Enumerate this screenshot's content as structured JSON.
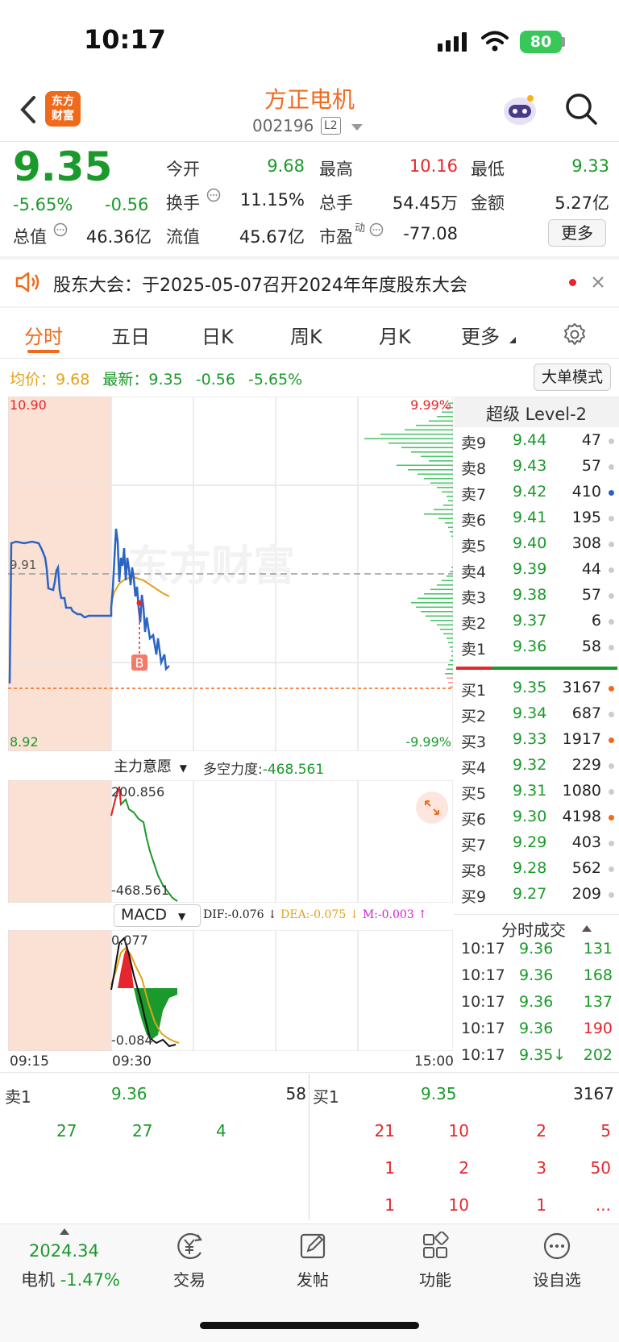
{
  "status_bar": {
    "time": "10:17",
    "battery": "80"
  },
  "header": {
    "logo_text": "东方\n财富",
    "title": "方正电机",
    "code": "002196",
    "level_badge": "L2"
  },
  "quote": {
    "price": "9.35",
    "change_pct": "-5.65%",
    "change": "-0.56",
    "open_label": "今开",
    "open": "9.68",
    "high_label": "最高",
    "high": "10.16",
    "low_label": "最低",
    "low": "9.33",
    "turnover_label": "换手",
    "turnover": "11.15%",
    "volume_label": "总手",
    "volume": "54.45万",
    "amount_label": "金额",
    "amount": "5.27亿",
    "mcap_label": "总值",
    "mcap": "46.36亿",
    "float_label": "流值",
    "float": "45.67亿",
    "pe_label": "市盈",
    "pe_sup": "动",
    "pe": "-77.08",
    "more_button": "更多"
  },
  "notice": {
    "text": "股东大会：于2025-05-07召开2024年年度股东大会"
  },
  "tabs": [
    "分时",
    "五日",
    "日K",
    "周K",
    "月K",
    "更多"
  ],
  "info_line": {
    "avg_label": "均价：",
    "avg": "9.68",
    "latest_label": "最新：",
    "latest": "9.35",
    "chg": "-0.56",
    "pct": "-5.65%"
  },
  "mode_button": "大单模式",
  "chart_labels": {
    "top_left": "10.90",
    "bottom_left": "8.92",
    "mid_left": "9.91",
    "top_right": "9.99%",
    "bottom_right": "-9.99%",
    "indicator1": "主力意愿",
    "indicator1_stat_label": "多空力度:",
    "indicator1_stat": "-468.561",
    "ind1_max": "200.856",
    "ind1_min": "-468.561",
    "macd": "MACD",
    "dif": "DIF:-0.076",
    "dea": "DEA:-0.075",
    "m": "M:-0.003",
    "macd_max": "0.077",
    "macd_min": "-0.084",
    "t_start": "09:15",
    "t_open": "09:30",
    "t_end": "15:00",
    "b_marker": "B"
  },
  "orderbook": {
    "title": "超级 Level-2",
    "asks": [
      {
        "side": "卖9",
        "price": "9.44",
        "vol": "47",
        "dot": "#cccccc"
      },
      {
        "side": "卖8",
        "price": "9.43",
        "vol": "57",
        "dot": "#cccccc"
      },
      {
        "side": "卖7",
        "price": "9.42",
        "vol": "410",
        "dot": "#2a5fc4"
      },
      {
        "side": "卖6",
        "price": "9.41",
        "vol": "195",
        "dot": "#cccccc"
      },
      {
        "side": "卖5",
        "price": "9.40",
        "vol": "308",
        "dot": "#cccccc"
      },
      {
        "side": "卖4",
        "price": "9.39",
        "vol": "44",
        "dot": "#cccccc"
      },
      {
        "side": "卖3",
        "price": "9.38",
        "vol": "57",
        "dot": "#cccccc"
      },
      {
        "side": "卖2",
        "price": "9.37",
        "vol": "6",
        "dot": "#cccccc"
      },
      {
        "side": "卖1",
        "price": "9.36",
        "vol": "58",
        "dot": "#cccccc"
      }
    ],
    "bids": [
      {
        "side": "买1",
        "price": "9.35",
        "vol": "3167",
        "dot": "#f06a1c"
      },
      {
        "side": "买2",
        "price": "9.34",
        "vol": "687",
        "dot": "#cccccc"
      },
      {
        "side": "买3",
        "price": "9.33",
        "vol": "1917",
        "dot": "#f06a1c"
      },
      {
        "side": "买4",
        "price": "9.32",
        "vol": "229",
        "dot": "#cccccc"
      },
      {
        "side": "买5",
        "price": "9.31",
        "vol": "1080",
        "dot": "#cccccc"
      },
      {
        "side": "买6",
        "price": "9.30",
        "vol": "4198",
        "dot": "#f06a1c"
      },
      {
        "side": "买7",
        "price": "9.29",
        "vol": "403",
        "dot": "#cccccc"
      },
      {
        "side": "买8",
        "price": "9.28",
        "vol": "562",
        "dot": "#cccccc"
      },
      {
        "side": "买9",
        "price": "9.27",
        "vol": "209",
        "dot": "#cccccc"
      }
    ],
    "trades_title": "分时成交",
    "trades": [
      {
        "time": "10:17",
        "price": "9.36",
        "vol": "131",
        "color": "#1a9a2a"
      },
      {
        "time": "10:17",
        "price": "9.36",
        "vol": "168",
        "color": "#1a9a2a"
      },
      {
        "time": "10:17",
        "price": "9.36",
        "vol": "137",
        "color": "#1a9a2a"
      },
      {
        "time": "10:17",
        "price": "9.36",
        "vol": "190",
        "color": "#e5262c"
      },
      {
        "time": "10:17",
        "price": "9.35↓",
        "vol": "202",
        "color": "#1a9a2a"
      }
    ]
  },
  "level_strip": {
    "sell_label": "卖1",
    "sell_price": "9.36",
    "sell_vol": "58",
    "buy_label": "买1",
    "buy_price": "9.35",
    "buy_vol": "3167",
    "sell_queue": [
      "27",
      "27",
      "4"
    ],
    "buy_queue": [
      [
        "21",
        "10",
        "2",
        "5"
      ],
      [
        "1",
        "2",
        "3",
        "50"
      ],
      [
        "1",
        "10",
        "1",
        "..."
      ]
    ]
  },
  "bottom_nav": {
    "index_value": "2024.34",
    "index_name": "电机",
    "index_pct": "-1.47%",
    "items": [
      "交易",
      "发帖",
      "功能",
      "设自选"
    ]
  },
  "colors": {
    "accent": "#f06a1c",
    "down": "#1a9a2a",
    "up": "#e5262c",
    "price_line": "#2a64c4",
    "avg_line": "#e3a21a"
  }
}
